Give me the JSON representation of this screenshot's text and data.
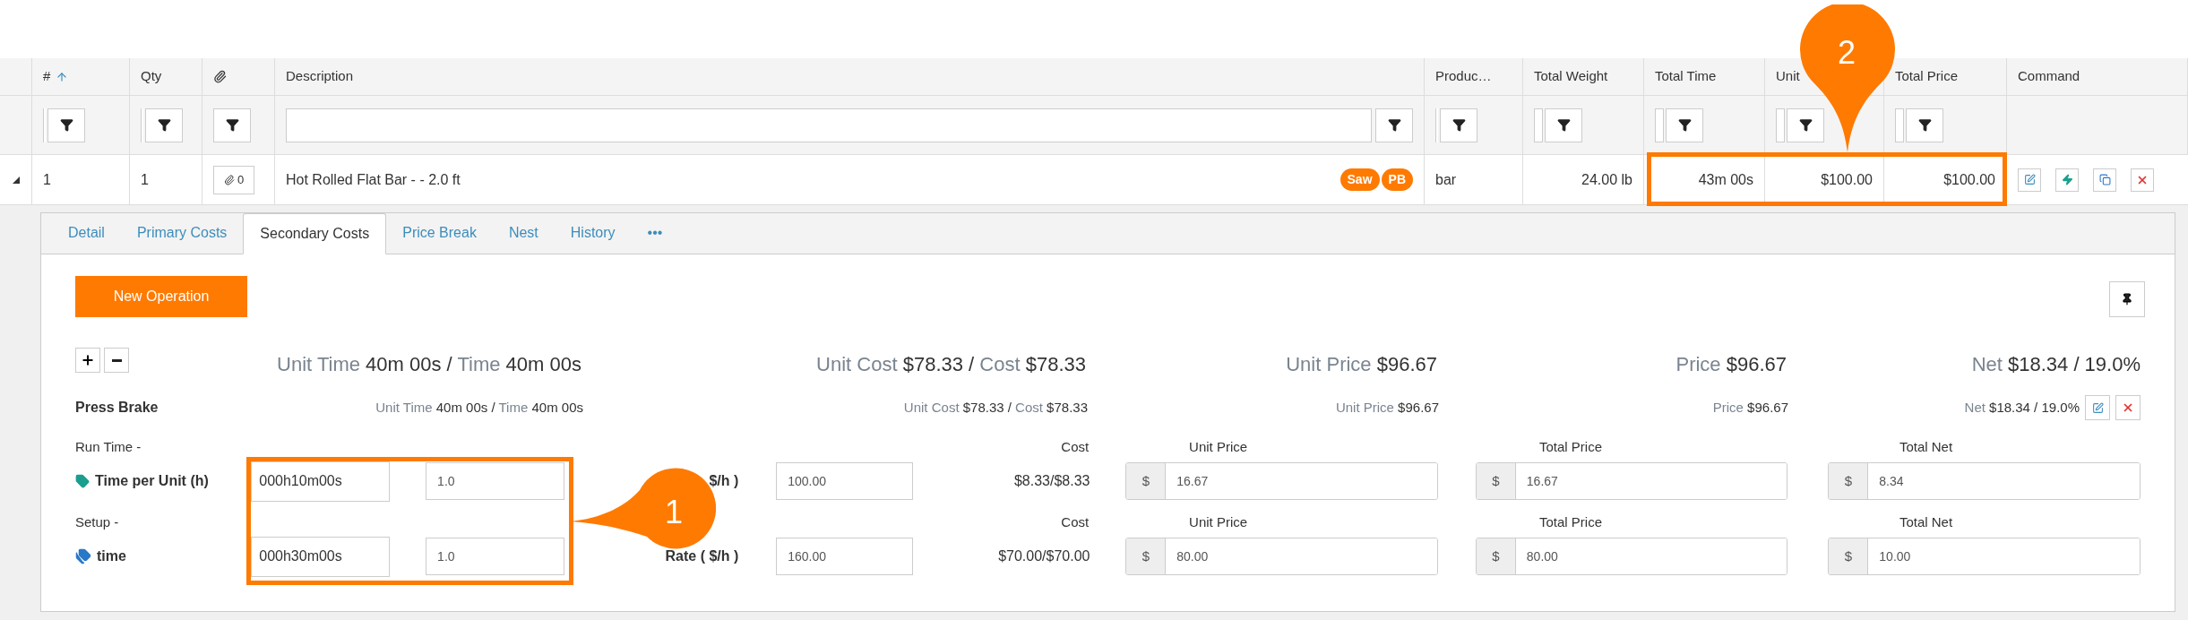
{
  "table": {
    "columns": [
      {
        "kind": "text",
        "label": "#",
        "sorted": true
      },
      {
        "kind": "text",
        "label": "Qty",
        "sorted": false
      },
      {
        "kind": "icon",
        "sorted": false
      },
      {
        "kind": "text",
        "label": "Description",
        "sorted": false
      },
      {
        "kind": "text",
        "label": "Produc…",
        "sorted": false
      },
      {
        "kind": "text",
        "label": "Total Weight",
        "sorted": false
      },
      {
        "kind": "text",
        "label": "Total Time",
        "sorted": false
      },
      {
        "kind": "text",
        "label": "Unit",
        "sorted": false
      },
      {
        "kind": "text",
        "label": "Total Price",
        "sorted": false
      },
      {
        "kind": "text",
        "label": "Command",
        "sorted": false
      }
    ],
    "rows": [
      {
        "expanded": true,
        "number": "1",
        "qty": "1",
        "attachments": "0",
        "description": "Hot Rolled Flat Bar - - 2.0 ft",
        "tags": [
          "Saw",
          "PB"
        ],
        "product": "bar",
        "total_weight": "24.00 lb",
        "total_time": "43m 00s",
        "unit_price": "$100.00",
        "total_price": "$100.00"
      }
    ]
  },
  "detail": {
    "tabs": [
      {
        "label": "Detail",
        "selected": false
      },
      {
        "label": "Primary Costs",
        "selected": false
      },
      {
        "label": "Secondary Costs",
        "selected": true
      },
      {
        "label": "Price Break",
        "selected": false
      },
      {
        "label": "Nest",
        "selected": false
      },
      {
        "label": "History",
        "selected": false
      },
      {
        "label": "•••",
        "selected": false
      }
    ],
    "new_operation_button": "New Operation",
    "summary": [
      {
        "parts": [
          {
            "label": "Unit Time",
            "value": "40m 00s"
          },
          {
            "label": "Time",
            "value": "40m 00s"
          }
        ]
      },
      {
        "parts": [
          {
            "label": "Unit Cost",
            "value": "$78.33"
          },
          {
            "label": "Cost",
            "value": "$78.33"
          }
        ]
      },
      {
        "parts": [
          {
            "label": "Unit Price",
            "value": "$96.67"
          }
        ]
      },
      {
        "parts": [
          {
            "label": "Price",
            "value": "$96.67"
          }
        ]
      },
      {
        "parts": [
          {
            "label": "Net",
            "value": "$18.34 / 19.0%"
          }
        ]
      }
    ],
    "separator": "/",
    "operation": {
      "name": "Press Brake",
      "summary": [
        {
          "parts": [
            {
              "label": "Unit Time",
              "value": "40m 00s"
            },
            {
              "label": "Time",
              "value": "40m 00s"
            }
          ]
        },
        {
          "parts": [
            {
              "label": "Unit Cost",
              "value": "$78.33"
            },
            {
              "label": "Cost",
              "value": "$78.33"
            }
          ]
        },
        {
          "parts": [
            {
              "label": "Unit Price",
              "value": "$96.67"
            }
          ]
        },
        {
          "parts": [
            {
              "label": "Price",
              "value": "$96.67"
            }
          ]
        },
        {
          "parts": [
            {
              "label": "Net",
              "value": "$18.34 / 19.0%"
            }
          ]
        }
      ]
    },
    "cost_rows": [
      {
        "kind": "tag",
        "section": "Run Time -",
        "name": "Time per Unit (h)",
        "time": "000h10m00s",
        "qty": "1.0",
        "rate_label": "$/h )",
        "rate": "100.00",
        "cost_label": "Cost",
        "cost": "$8.33/$8.33",
        "currency": "$",
        "unit_price_label": "Unit Price",
        "unit_price": "16.67",
        "total_price_label": "Total Price",
        "total_price": "16.67",
        "total_net_label": "Total Net",
        "total_net": "8.34"
      },
      {
        "kind": "tags",
        "section": "Setup -",
        "name": "time",
        "time": "000h30m00s",
        "qty": "1.0",
        "rate_label": "Rate ( $/h )",
        "rate": "160.00",
        "cost_label": "Cost",
        "cost": "$70.00/$70.00",
        "currency": "$",
        "unit_price_label": "Unit Price",
        "unit_price": "80.00",
        "total_price_label": "Total Price",
        "total_price": "80.00",
        "total_net_label": "Total Net",
        "total_net": "10.00"
      }
    ]
  },
  "callouts": [
    {
      "label": "1"
    },
    {
      "label": "2"
    }
  ]
}
